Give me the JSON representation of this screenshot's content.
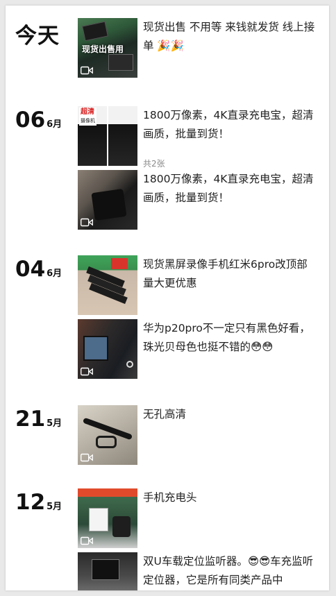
{
  "days": [
    {
      "label": "今天",
      "posts": [
        {
          "caption": "现货出售 不用等 来钱就发货 线上接单 🎉🎉",
          "overlay": "现货出售用",
          "video": true
        }
      ]
    },
    {
      "day": "06",
      "month": "6月",
      "posts": [
        {
          "caption": "1800万像素，4K直录充电宝，超清画质，批量到货！",
          "count": "共2张",
          "banner_title": "超清",
          "banner_sub": "摄像机",
          "video": false
        },
        {
          "caption": "1800万像素，4K直录充电宝，超清画质，批量到货！",
          "video": true
        }
      ]
    },
    {
      "day": "04",
      "month": "6月",
      "posts": [
        {
          "caption": "现货黑屏录像手机红米6pro改顶部量大更优惠",
          "video": false
        },
        {
          "caption": "华为p20pro不一定只有黑色好看，珠光贝母色也挺不错的😳😳",
          "video": true
        }
      ]
    },
    {
      "day": "21",
      "month": "5月",
      "posts": [
        {
          "caption": "无孔高清",
          "video": true
        }
      ]
    },
    {
      "day": "12",
      "month": "5月",
      "posts": [
        {
          "caption": "手机充电头",
          "video": true
        },
        {
          "caption": "双U车载定位监听器。😎😎车充监听定位器，它是所有同类产品中",
          "video": false
        }
      ]
    }
  ],
  "colors": {
    "background": "#e9e9e9",
    "card": "#ffffff",
    "text": "#222222",
    "muted": "#888888"
  }
}
